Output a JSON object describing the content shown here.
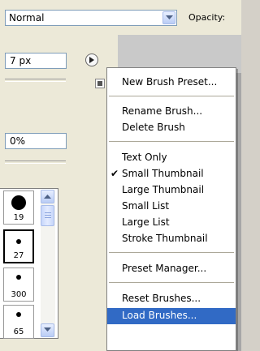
{
  "options_bar": {
    "mode_value": "Normal",
    "opacity_label": "Opacity:"
  },
  "brush_panel": {
    "size_value": "7 px",
    "hardness_value": "0%",
    "presets": [
      {
        "size_label": "19"
      },
      {
        "size_label": "27"
      },
      {
        "size_label": "300"
      },
      {
        "size_label": "65"
      }
    ]
  },
  "flyout_menu": {
    "items": [
      {
        "label": "New Brush Preset..."
      },
      {
        "label": "Rename Brush..."
      },
      {
        "label": "Delete Brush"
      },
      {
        "label": "Text Only"
      },
      {
        "label": "Small Thumbnail",
        "checked": true
      },
      {
        "label": "Large Thumbnail"
      },
      {
        "label": "Small List"
      },
      {
        "label": "Large List"
      },
      {
        "label": "Stroke Thumbnail"
      },
      {
        "label": "Preset Manager..."
      },
      {
        "label": "Reset Brushes..."
      },
      {
        "label": "Load Brushes...",
        "highlighted": true
      }
    ],
    "check_glyph": "✔"
  },
  "colors": {
    "highlight": "#316ac5",
    "panel_bg": "#ece9d8",
    "canvas_bg": "#a7a7a7"
  }
}
